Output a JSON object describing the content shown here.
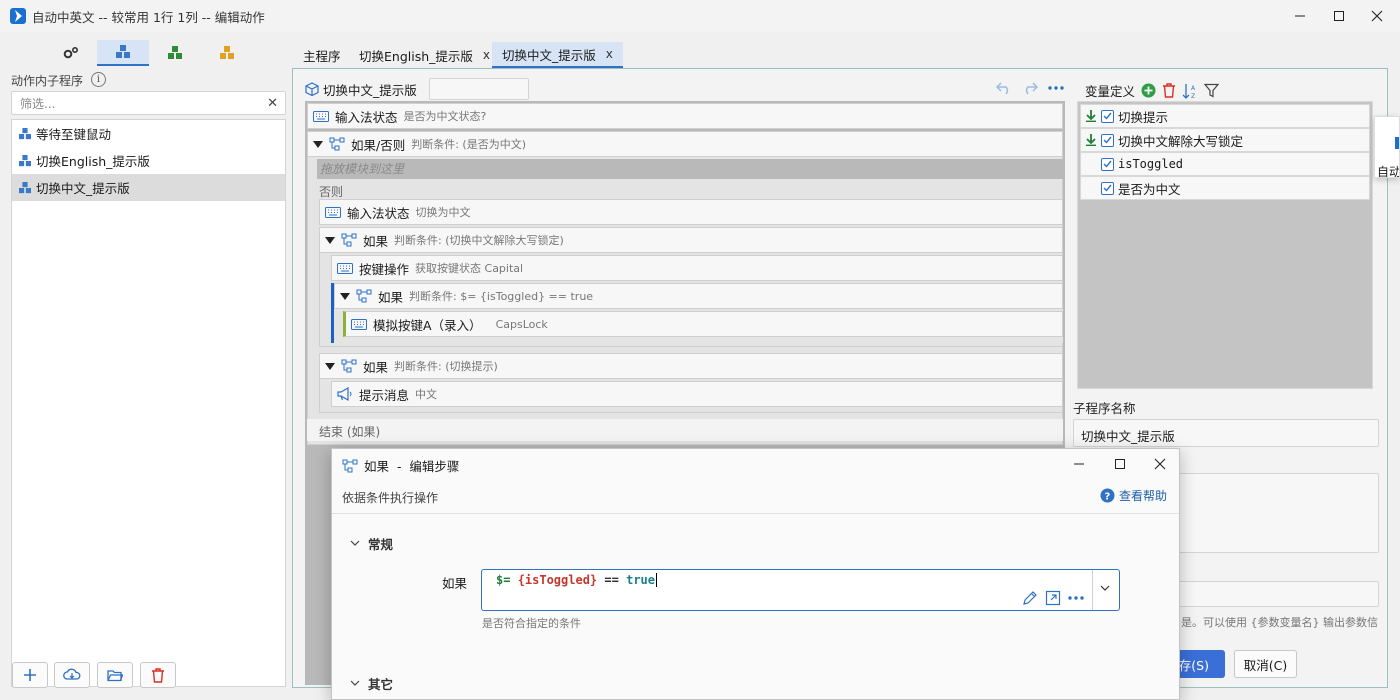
{
  "window": {
    "title": "自动中英文 -- 较常用 1行 1列 -- 编辑动作"
  },
  "left": {
    "section_title": "动作内子程序",
    "filter_placeholder": "筛选...",
    "items": [
      {
        "label": "等待至键鼠动"
      },
      {
        "label": "切换English_提示版"
      },
      {
        "label": "切换中文_提示版"
      }
    ]
  },
  "tabs": [
    {
      "label": "主程序"
    },
    {
      "label": "切换English_提示版",
      "close": "x"
    },
    {
      "label": "切换中文_提示版",
      "close": "x"
    }
  ],
  "canvas": {
    "title": "切换中文_提示版",
    "steps": {
      "s1": {
        "label": "输入法状态",
        "desc": "是否为中文状态?"
      },
      "s2": {
        "label": "如果/否则",
        "desc": "判断条件: (是否为中文)"
      },
      "drop_hint": "拖放模块到这里",
      "else_label": "否则",
      "s3": {
        "label": "输入法状态",
        "desc": "切换为中文"
      },
      "s4": {
        "label": "如果",
        "desc": "判断条件: (切换中文解除大写锁定)"
      },
      "s5": {
        "label": "按键操作",
        "desc": "获取按键状态 Capital"
      },
      "s6": {
        "label": "如果",
        "desc": "判断条件: $= {isToggled} == true"
      },
      "s7": {
        "label": "模拟按键A（录入）",
        "desc": "CapsLock"
      },
      "s8": {
        "label": "如果",
        "desc": "判断条件: (切换提示)"
      },
      "s9": {
        "label": "提示消息",
        "desc": "中文"
      },
      "end_label": "结束 (如果)"
    }
  },
  "variables": {
    "title": "变量定义",
    "items": [
      {
        "name": "切换提示"
      },
      {
        "name": "切换中文解除大写锁定"
      },
      {
        "name": "isToggled"
      },
      {
        "name": "是否为中文"
      }
    ]
  },
  "right": {
    "subname_label": "子程序名称",
    "subname_value": "切换中文_提示版",
    "hint_tail": "是。可以使用 {参数变量名} 输出参数信"
  },
  "dialog": {
    "title": "如果  -  编辑步骤",
    "subtitle": "依据条件执行操作",
    "help": "查看帮助",
    "section_general": "常规",
    "cond_label": "如果",
    "cond_prefix": "$=",
    "cond_var": "{isToggled}",
    "cond_op": "==",
    "cond_value": "true",
    "cond_hint": "是否符合指定的条件",
    "section_other": "其它"
  },
  "footer": {
    "save": "存(S)",
    "cancel": "取消(C)"
  },
  "popup": {
    "text": "自动"
  },
  "colors": {
    "accent": "#2f71c4",
    "green": "#1e8e3e",
    "red": "#d93025"
  }
}
